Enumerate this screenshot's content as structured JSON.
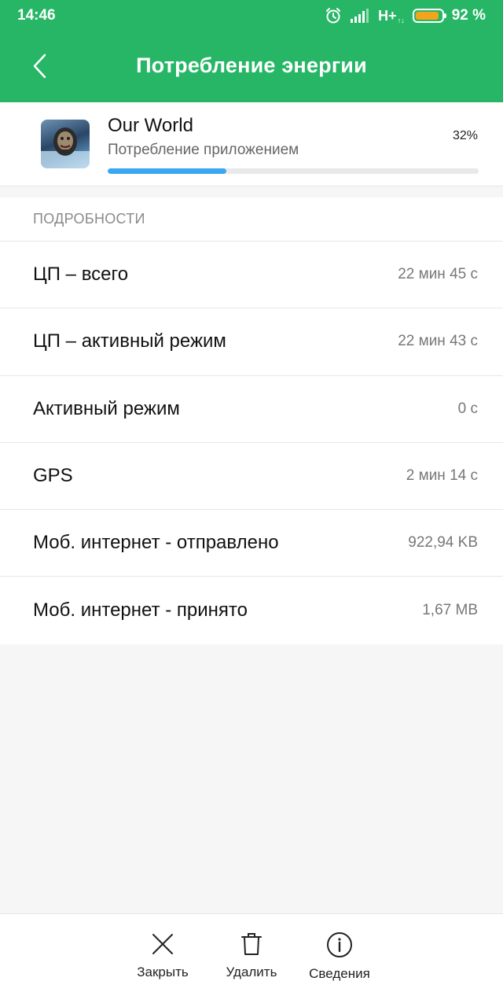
{
  "status_bar": {
    "time": "14:46",
    "network": "H+",
    "battery_percent_text": "92 %",
    "battery_level": 0.92,
    "icons": [
      "alarm-icon",
      "signal-icon",
      "battery-icon"
    ]
  },
  "header": {
    "title": "Потребление энергии",
    "back_icon": "chevron-left-icon"
  },
  "app": {
    "name": "Our World",
    "subtitle": "Потребление приложением",
    "percent_text": "32%",
    "usage_fraction": 0.32
  },
  "details": {
    "section_label": "ПОДРОБНОСТИ",
    "rows": [
      {
        "label": "ЦП – всего",
        "value": "22 мин 45 с"
      },
      {
        "label": "ЦП – активный режим",
        "value": "22 мин 43 с"
      },
      {
        "label": "Активный режим",
        "value": "0 с"
      },
      {
        "label": "GPS",
        "value": "2 мин 14 с"
      },
      {
        "label": "Моб. интернет - отправлено",
        "value": "922,94 KB"
      },
      {
        "label": "Моб. интернет - принято",
        "value": "1,67 MB"
      }
    ]
  },
  "actions": {
    "close_label": "Закрыть",
    "delete_label": "Удалить",
    "info_label": "Сведения"
  },
  "colors": {
    "header_bg": "#27b666",
    "progress": "#3aa7f0",
    "battery": "#f2a51a"
  }
}
